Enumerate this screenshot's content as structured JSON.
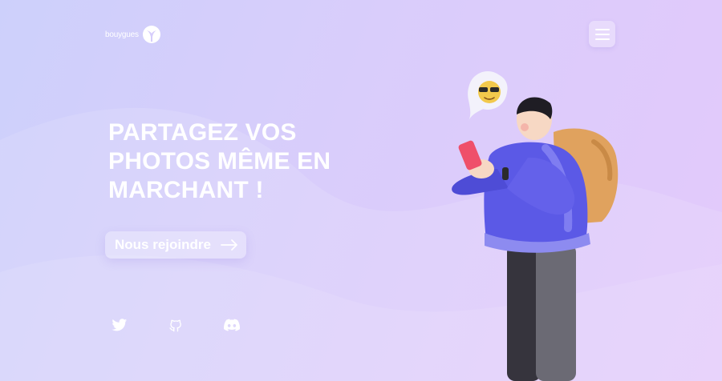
{
  "header": {
    "logo_text": "bouygues",
    "logo_icon": "bouygues-logo-icon",
    "menu_icon": "hamburger-menu-icon"
  },
  "hero": {
    "title_lines": [
      "PARTAGEZ VOS",
      "PHOTOS MÊME EN",
      "MARCHANT !"
    ],
    "cta_label": "Nous rejoindre",
    "cta_icon": "arrow-right-icon"
  },
  "socials": [
    {
      "name": "Twitter",
      "icon": "twitter-icon"
    },
    {
      "name": "GitHub",
      "icon": "github-icon"
    },
    {
      "name": "Discord",
      "icon": "discord-icon"
    }
  ],
  "illustration": {
    "subject": "3d-character-with-phone-and-backpack",
    "speech_bubble_icon": "sunglasses-emoji-icon"
  },
  "colors": {
    "background_start": "#cdd0fb",
    "background_end": "#e3c9fb",
    "text": "#ffffff",
    "jacket": "#5b59e6",
    "backpack": "#e0a25e"
  }
}
